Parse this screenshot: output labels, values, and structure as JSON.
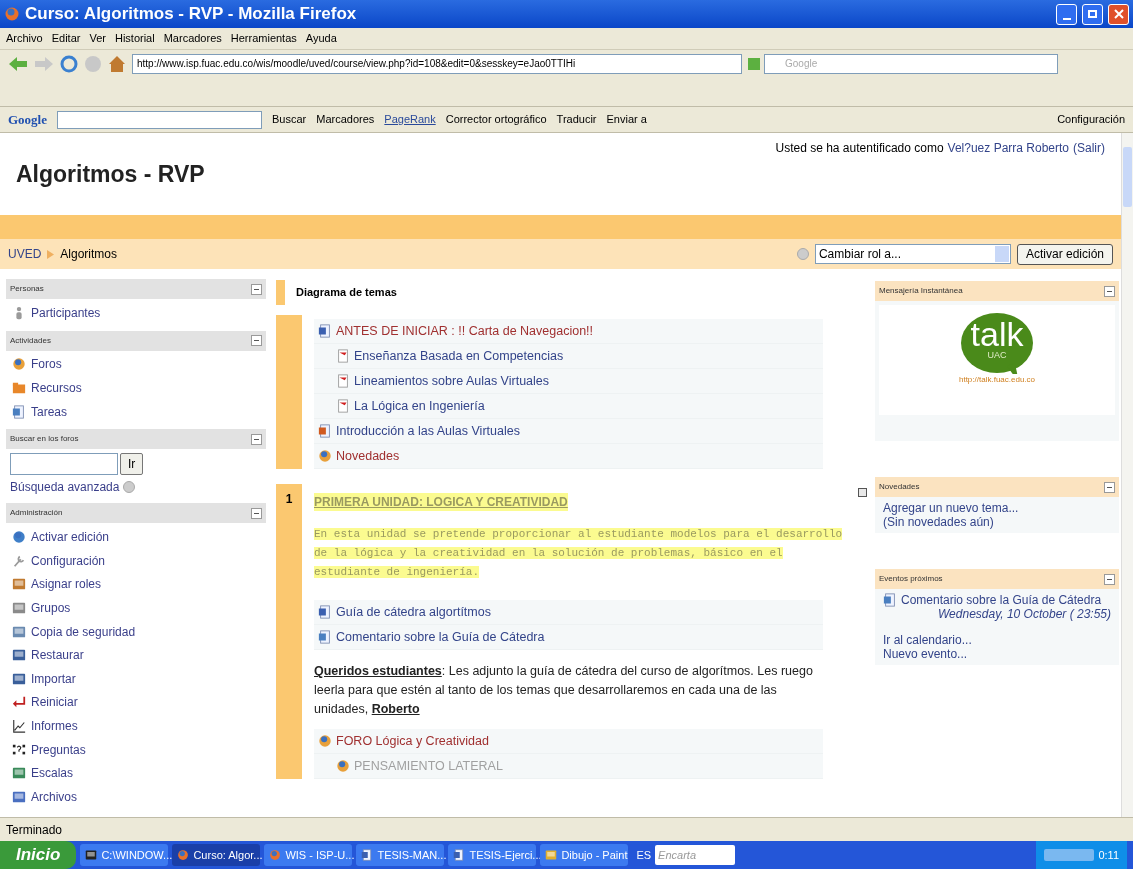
{
  "window": {
    "title": "Curso: Algoritmos - RVP - Mozilla Firefox"
  },
  "menu": [
    "Archivo",
    "Editar",
    "Ver",
    "Historial",
    "Marcadores",
    "Herramientas",
    "Ayuda"
  ],
  "address": {
    "url": "http://www.isp.fuac.edu.co/wis/moodle/uved/course/view.php?id=108&edit=0&sesskey=eJao0TTIHi"
  },
  "search": {
    "placeholder": "Google"
  },
  "google_toolbar": {
    "logo": "Google",
    "items": [
      {
        "label": "Buscar",
        "kind": "search"
      },
      {
        "label": "Marcadores",
        "kind": "star"
      },
      {
        "label": "PageRank",
        "kind": "pagerank"
      },
      {
        "label": "Corrector ortográfico",
        "kind": "spell"
      },
      {
        "label": "Traducir",
        "kind": "translate"
      },
      {
        "label": "Enviar a",
        "kind": "send"
      }
    ],
    "settings": "Configuración"
  },
  "page": {
    "title": "Algoritmos - RVP",
    "login": {
      "prefix": "Usted se ha autentificado como",
      "user": "Vel?uez Parra Roberto",
      "logout": "(Salir)"
    },
    "breadcrumb": [
      "UVED",
      "Algoritmos"
    ],
    "role_select": {
      "value": "Cambiar rol a..."
    },
    "edit_button": "Activar edición"
  },
  "left_blocks": [
    {
      "title": "Personas",
      "kind": "list",
      "items": [
        {
          "label": "Participantes",
          "kind": "person"
        }
      ]
    },
    {
      "title": "Actividades",
      "kind": "list",
      "items": [
        {
          "label": "Foros",
          "kind": "forum"
        },
        {
          "label": "Recursos",
          "kind": "folder"
        },
        {
          "label": "Tareas",
          "kind": "assignment"
        }
      ]
    },
    {
      "title": "Buscar en los foros",
      "kind": "search",
      "button": "Ir",
      "link": "Búsqueda avanzada"
    },
    {
      "title": "Administración",
      "kind": "list",
      "items": [
        {
          "label": "Activar edición",
          "kind": "edit"
        },
        {
          "label": "Configuración",
          "kind": "wrench"
        },
        {
          "label": "Asignar roles",
          "kind": "roles"
        },
        {
          "label": "Grupos",
          "kind": "groups"
        },
        {
          "label": "Copia de seguridad",
          "kind": "backup"
        },
        {
          "label": "Restaurar",
          "kind": "restore"
        },
        {
          "label": "Importar",
          "kind": "restore"
        },
        {
          "label": "Reiniciar",
          "kind": "reset"
        },
        {
          "label": "Informes",
          "kind": "chart"
        },
        {
          "label": "Preguntas",
          "kind": "questions"
        },
        {
          "label": "Escalas",
          "kind": "scales"
        },
        {
          "label": "Archivos",
          "kind": "files"
        }
      ]
    }
  ],
  "topics": {
    "title": "Diagrama de temas",
    "sections": [
      {
        "resources": [
          {
            "label": "ANTES DE INICIAR : !! Carta de Navegacion!!",
            "kind": "word",
            "visited": true,
            "dimmed": false,
            "children": [
              {
                "label": "Enseñanza Basada en Competencias",
                "kind": "pdf",
                "visited": false,
                "dimmed": false
              },
              {
                "label": "Lineamientos sobre Aulas Virtuales",
                "kind": "pdf",
                "visited": false,
                "dimmed": false
              },
              {
                "label": "La Lógica en Ingeniería",
                "kind": "pdf",
                "visited": false,
                "dimmed": false
              }
            ]
          },
          {
            "label": "Introducción a las Aulas Virtuales",
            "kind": "ppt",
            "visited": false,
            "dimmed": false
          },
          {
            "label": "Novedades",
            "kind": "forum",
            "visited": true,
            "dimmed": false
          }
        ]
      },
      {
        "number": "1",
        "title": "PRIMERA UNIDAD: LOGICA Y CREATIVIDAD",
        "summary": "En esta unidad se pretende proporcionar al estudiante modelos para el desarrollo de la lógica y la creatividad en la solución de problemas, básico en el estudiante de ingeniería.",
        "resources": [
          {
            "label": "Guía de cátedra algortítmos",
            "kind": "word",
            "visited": false,
            "dimmed": false
          },
          {
            "label": "Comentario sobre la Guía de Cátedra",
            "kind": "assignment",
            "visited": false,
            "dimmed": false
          }
        ],
        "note": "**Queridos estudiantes**: Les adjunto la guía de cátedra del curso de algorítmos. Les ruego leerla para que estén al tanto de los temas que desarrollaremos en cada una de las unidades, **Roberto**",
        "forums": [
          {
            "label": "FORO Lógica y Creatividad",
            "kind": "forum",
            "visited": true,
            "dimmed": false,
            "children": [
              {
                "label": "PENSAMIENTO LATERAL",
                "kind": "forum",
                "visited": false,
                "dimmed": true
              }
            ]
          }
        ]
      }
    ]
  },
  "right_blocks": [
    {
      "title": "Mensajería Instantánea",
      "kind": "logo",
      "logo": {
        "word": "talk",
        "sub": "UAC",
        "url": "http://talk.fuac.edu.co"
      }
    },
    {
      "title": "Novedades",
      "kind": "news",
      "link": "Agregar un nuevo tema...",
      "text": "(Sin novedades aún)"
    },
    {
      "title": "Eventos próximos",
      "kind": "events",
      "event": {
        "label": "Comentario sobre la Guía de Cátedra",
        "date": "Wednesday, 10 October ( 23:55)"
      },
      "links": [
        "Ir al calendario...",
        "Nuevo evento..."
      ]
    }
  ],
  "status_bar": "Terminado",
  "taskbar": {
    "start": "Inicio",
    "tasks": [
      {
        "label": "C:\\WINDOW...",
        "kind": "console",
        "selected": false
      },
      {
        "label": "Curso: Algor...",
        "kind": "firefox",
        "selected": true
      },
      {
        "label": "WIS - ISP-U...",
        "kind": "firefox",
        "selected": false
      },
      {
        "label": "TESIS-MAN...",
        "kind": "word",
        "selected": false
      },
      {
        "label": "TESIS-Ejerci...",
        "kind": "word",
        "selected": false
      },
      {
        "label": "Dibujo - Paint",
        "kind": "paint",
        "selected": false
      }
    ],
    "language": "ES",
    "search_placeholder": "Encarta",
    "clock": "0:11"
  }
}
